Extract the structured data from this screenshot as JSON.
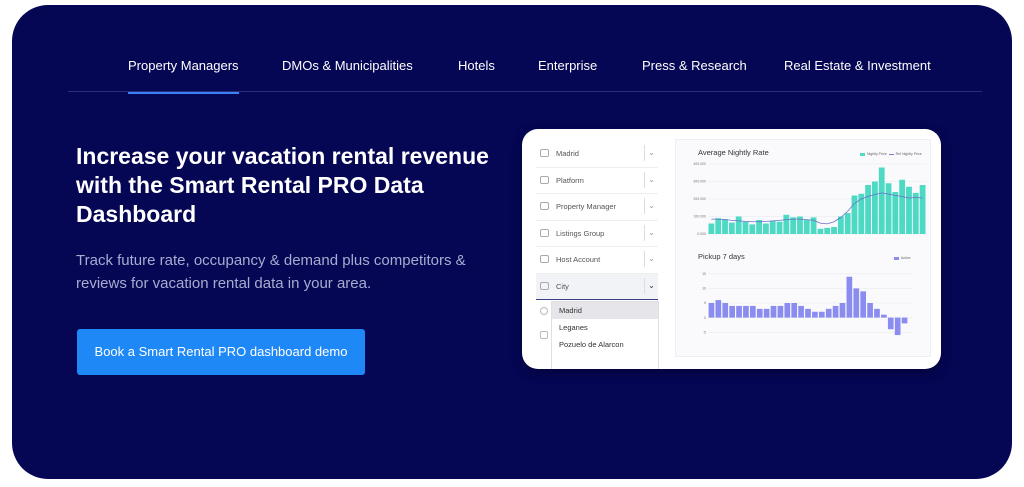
{
  "tabs": [
    {
      "label": "Property Managers",
      "active": true
    },
    {
      "label": "DMOs & Municipalities",
      "active": false
    },
    {
      "label": "Hotels",
      "active": false
    },
    {
      "label": "Enterprise",
      "active": false
    },
    {
      "label": "Press & Research",
      "active": false
    },
    {
      "label": "Real Estate & Investment",
      "active": false
    }
  ],
  "hero": {
    "headline": "Increase your vacation rental revenue with the Smart Rental PRO Data Dashboard",
    "subtext": "Track future rate, occupancy & demand plus competitors & reviews for vacation rental data in your area.",
    "cta_label": "Book a Smart Rental PRO dashboard demo"
  },
  "dashboard": {
    "filters": [
      {
        "label": "Madrid",
        "icon": "map-icon"
      },
      {
        "label": "Platform",
        "icon": "platform-icon"
      },
      {
        "label": "Property Manager",
        "icon": "link-icon"
      },
      {
        "label": "Listings Group",
        "icon": "list-icon"
      },
      {
        "label": "Host Account",
        "icon": "user-icon"
      },
      {
        "label": "City",
        "icon": "building-icon"
      }
    ],
    "city_options": [
      "Madrid",
      "Leganes",
      "Pozuelo de Alarcon"
    ],
    "selected_city": "Madrid"
  },
  "colors": {
    "background": "#050654",
    "accent": "#1e88f6",
    "teal": "#4dd9c4",
    "purple": "#8b8cf0"
  },
  "chart_data": [
    {
      "type": "bar",
      "title": "Average Nightly Rate",
      "legend": [
        "Nightly Price",
        "Ref Nightly Price"
      ],
      "yticks": [
        "400.000",
        "300.000",
        "200.000",
        "100.000",
        "0.000"
      ],
      "ylim": [
        0,
        400
      ],
      "series": [
        {
          "name": "Nightly Price",
          "values": [
            60,
            90,
            85,
            65,
            100,
            70,
            55,
            80,
            60,
            75,
            70,
            110,
            95,
            100,
            80,
            95,
            30,
            35,
            40,
            100,
            120,
            220,
            230,
            280,
            300,
            380,
            290,
            240,
            310,
            270,
            235,
            280
          ]
        },
        {
          "name": "Ref Nightly Price",
          "values": [
            85,
            85,
            82,
            78,
            75,
            72,
            70,
            70,
            72,
            75,
            78,
            82,
            85,
            85,
            82,
            78,
            62,
            58,
            70,
            95,
            130,
            175,
            200,
            215,
            225,
            235,
            228,
            220,
            215,
            205,
            210,
            205
          ]
        }
      ]
    },
    {
      "type": "bar",
      "title": "Pickup 7 days",
      "legend": [
        "Active"
      ],
      "yticks": [
        "15",
        "10",
        "5",
        "0",
        "-5"
      ],
      "ylim": [
        -7,
        17
      ],
      "series": [
        {
          "name": "Active",
          "values": [
            5,
            6,
            5,
            4,
            4,
            4,
            4,
            3,
            3,
            4,
            4,
            5,
            5,
            4,
            3,
            2,
            2,
            3,
            4,
            5,
            14,
            10,
            9,
            5,
            3,
            1,
            -4,
            -6,
            -2
          ]
        }
      ]
    }
  ]
}
